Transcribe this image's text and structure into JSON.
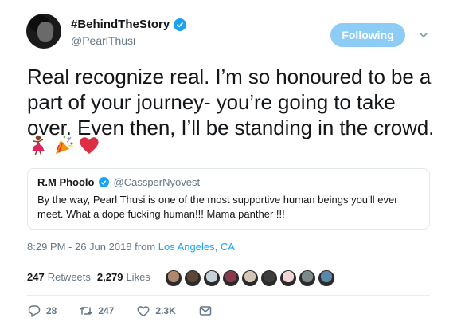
{
  "author": {
    "display_name": "#BehindTheStory",
    "handle": "@PearlThusi",
    "verified": true,
    "avatar": "profile-photo-woman"
  },
  "follow_button": {
    "label": "Following",
    "color": "#8dcdf5"
  },
  "tweet": {
    "text": "Real recognize real. I’m so honoured to be a part of your journey- you’re going to take over. Even then, I’ll be standing in the crowd.",
    "emojis": [
      "dancer-emoji",
      "party-popper-emoji",
      "red-heart-emoji"
    ]
  },
  "quoted_tweet": {
    "name": "R.M Phoolo",
    "handle": "@CassperNyovest",
    "verified": true,
    "text": "By the way, Pearl Thusi is one of the most supportive human beings you’ll ever meet. What a dope fucking human!!! Mama panther !!!"
  },
  "meta": {
    "time_date": "8:29 PM - 26 Jun 2018 from",
    "location": "Los Angeles, CA"
  },
  "stats": {
    "retweets_count": "247",
    "retweets_label": "Retweets",
    "likes_count": "2,279",
    "likes_label": "Likes",
    "liker_avatar_colors": [
      "#b0876c",
      "#5c4636",
      "#c7d1d9",
      "#8a3a4a",
      "#d4c7b5",
      "#3e3e3e",
      "#f2d6d6",
      "#7d8a8a",
      "#5a88a8"
    ]
  },
  "actions": {
    "reply_count": "28",
    "retweet_count": "247",
    "like_count": "2.3K"
  },
  "colors": {
    "accent": "#1da1f2",
    "text": "#14171a",
    "secondary": "#657786"
  }
}
